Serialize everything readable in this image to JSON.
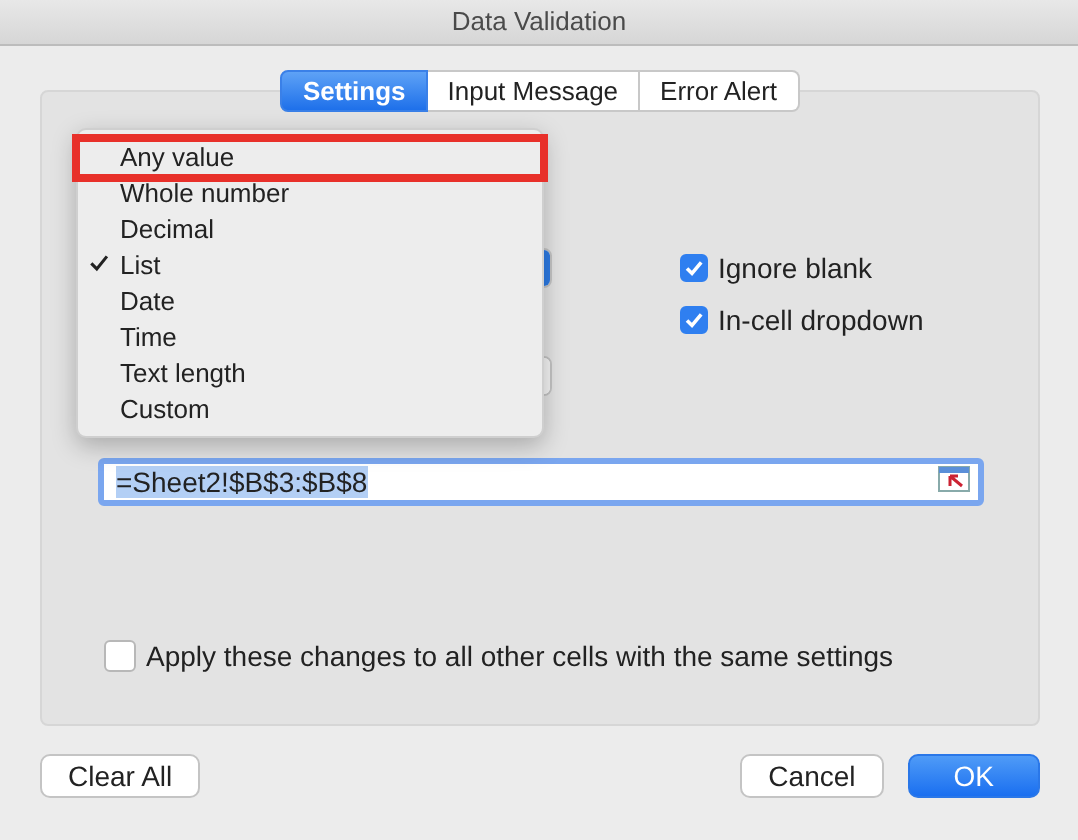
{
  "window": {
    "title": "Data Validation"
  },
  "tabs": [
    {
      "label": "Settings",
      "selected": true
    },
    {
      "label": "Input Message",
      "selected": false
    },
    {
      "label": "Error Alert",
      "selected": false
    }
  ],
  "allow_menu": {
    "items": [
      {
        "label": "Any value",
        "checked": false,
        "outlined": true
      },
      {
        "label": "Whole number",
        "checked": false,
        "outlined": false
      },
      {
        "label": "Decimal",
        "checked": false,
        "outlined": false
      },
      {
        "label": "List",
        "checked": true,
        "outlined": false
      },
      {
        "label": "Date",
        "checked": false,
        "outlined": false
      },
      {
        "label": "Time",
        "checked": false,
        "outlined": false
      },
      {
        "label": "Text length",
        "checked": false,
        "outlined": false
      },
      {
        "label": "Custom",
        "checked": false,
        "outlined": false
      }
    ]
  },
  "options": [
    {
      "label": "Ignore blank",
      "checked": true
    },
    {
      "label": "In-cell dropdown",
      "checked": true
    }
  ],
  "source_field": {
    "value": "=Sheet2!$B$3:$B$8"
  },
  "apply_all": {
    "label": "Apply these changes to all other cells with the same settings",
    "checked": false
  },
  "buttons": [
    {
      "label": "Clear All",
      "kind": "secondary"
    },
    {
      "label": "Cancel",
      "kind": "secondary"
    },
    {
      "label": "OK",
      "kind": "default"
    }
  ]
}
